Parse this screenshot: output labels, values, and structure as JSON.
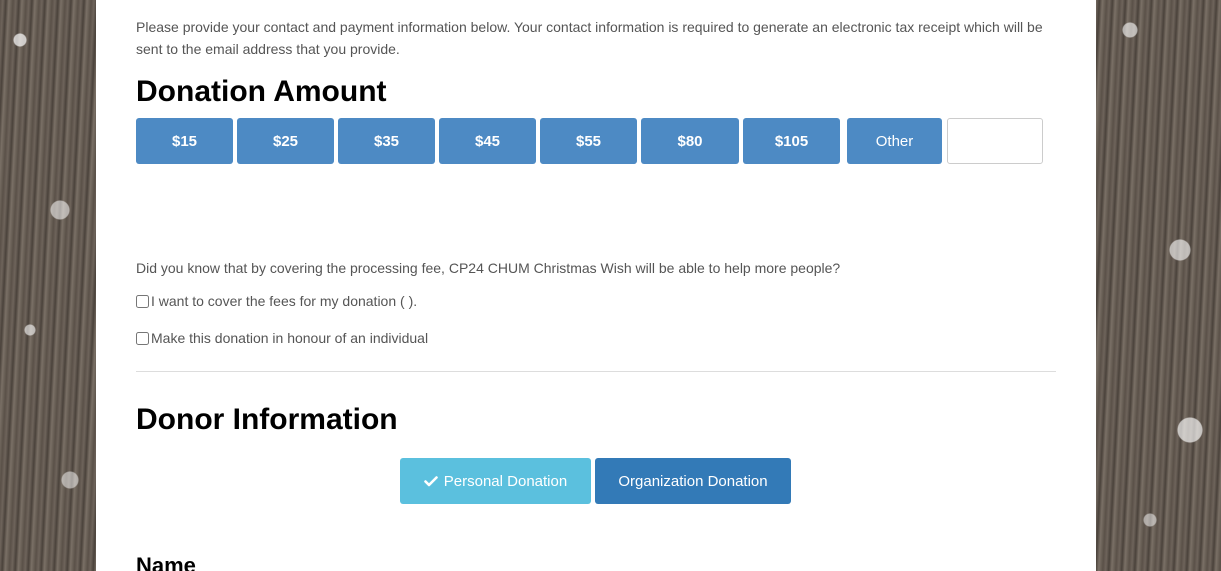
{
  "intro_text": "Please provide your contact and payment information below. Your contact information is required to generate an electronic tax receipt which will be sent to the email address that you provide.",
  "donation_amount": {
    "title": "Donation Amount",
    "amounts": [
      "$15",
      "$25",
      "$35",
      "$45",
      "$55",
      "$80",
      "$105"
    ],
    "other_label": "Other",
    "other_value": ""
  },
  "fees": {
    "question": "Did you know that by covering the processing fee, CP24 CHUM Christmas Wish will be able to help more people?",
    "cover_fees_label": "I want to cover the fees for my donation ( ).",
    "honour_label": "Make this donation in honour of an individual"
  },
  "donor": {
    "title": "Donor Information",
    "personal_label": "Personal Donation",
    "organization_label": "Organization Donation",
    "selected": "Personal Donation",
    "name_heading": "Name"
  },
  "colors": {
    "amount_button": "#4d8ac4",
    "personal_button": "#5bc0de",
    "organization_button": "#337ab7"
  },
  "icons": {
    "selected_check": "check-icon"
  }
}
